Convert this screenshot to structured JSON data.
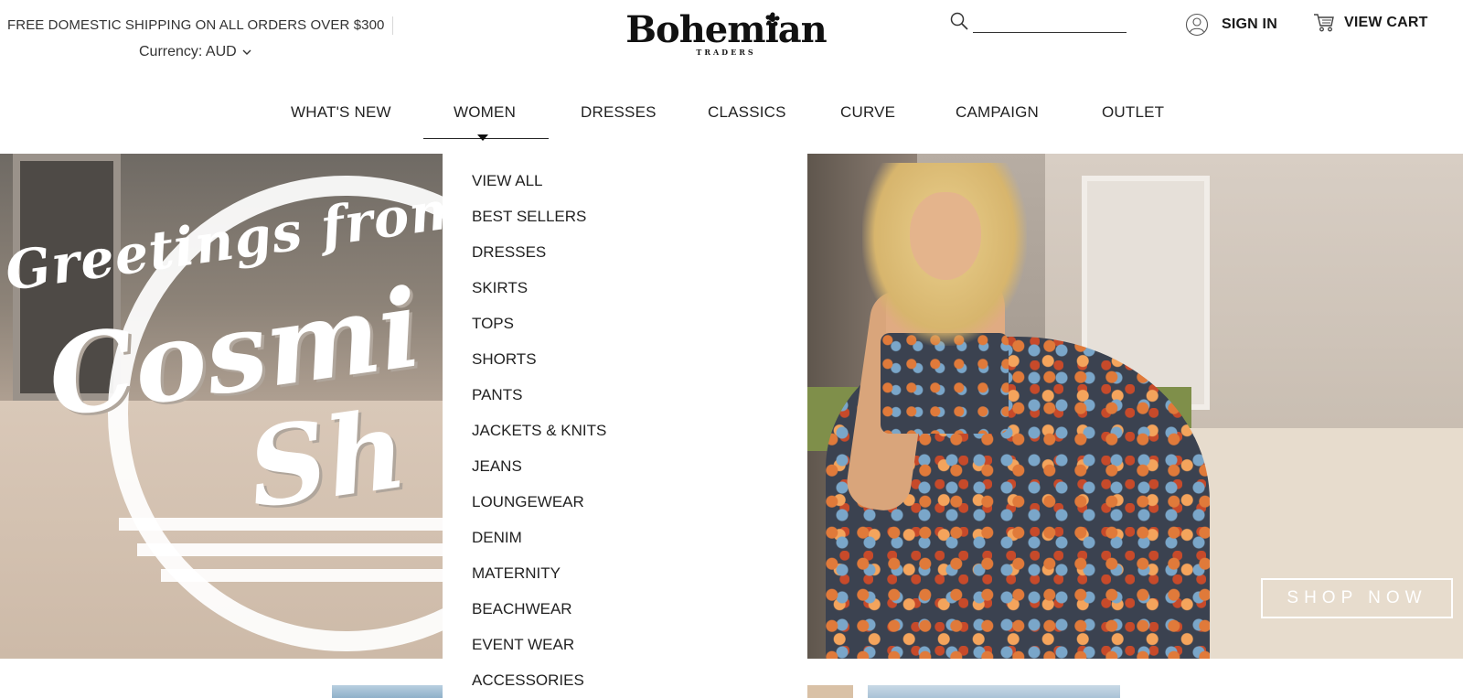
{
  "header": {
    "promo_text": "FREE DOMESTIC SHIPPING ON ALL ORDERS OVER $300",
    "currency_label": "Currency: AUD",
    "logo_text": "Bohemian",
    "logo_subtext": "TRADERS",
    "search_placeholder": "",
    "sign_in_label": "SIGN IN",
    "view_cart_label": "VIEW CART"
  },
  "nav": {
    "items": [
      {
        "label": "WHAT'S NEW"
      },
      {
        "label": "WOMEN"
      },
      {
        "label": "DRESSES"
      },
      {
        "label": "CLASSICS"
      },
      {
        "label": "CURVE"
      },
      {
        "label": "CAMPAIGN"
      },
      {
        "label": "OUTLET"
      }
    ],
    "active": "WOMEN"
  },
  "dropdown": {
    "items": [
      {
        "label": "VIEW ALL"
      },
      {
        "label": "BEST SELLERS"
      },
      {
        "label": "DRESSES"
      },
      {
        "label": "SKIRTS"
      },
      {
        "label": "TOPS"
      },
      {
        "label": "SHORTS"
      },
      {
        "label": "PANTS"
      },
      {
        "label": "JACKETS & KNITS"
      },
      {
        "label": "JEANS"
      },
      {
        "label": "LOUNGEWEAR"
      },
      {
        "label": "DENIM"
      },
      {
        "label": "MATERNITY"
      },
      {
        "label": "BEACHWEAR"
      },
      {
        "label": "EVENT WEAR"
      },
      {
        "label": "ACCESSORIES"
      }
    ]
  },
  "hero": {
    "left_line1": "Greetings from",
    "left_line2": "Cosmi",
    "left_line3": "Sh",
    "shop_now_label": "SHOP NOW"
  },
  "icons": {
    "search": "search-icon",
    "user": "user-icon",
    "cart": "cart-icon",
    "chevron": "chevron-down-icon"
  },
  "colors": {
    "text": "#1a1a1a",
    "background": "#ffffff",
    "button_border": "#ffffff"
  }
}
